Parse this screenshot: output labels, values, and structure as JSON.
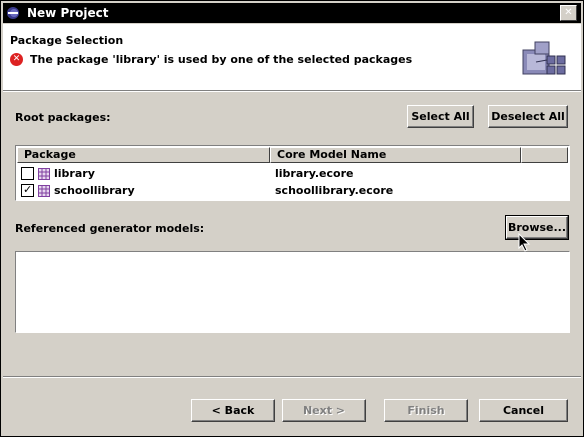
{
  "window": {
    "title": "New Project",
    "close_glyph": "✕"
  },
  "header": {
    "title": "Package Selection",
    "error_message": "The package 'library' is used by one of the selected packages",
    "error_icon": "error-icon",
    "wizard_icon": "package-wizard-icon"
  },
  "root_packages": {
    "label": "Root packages:",
    "select_all": "Select All",
    "deselect_all": "Deselect All",
    "columns": [
      "Package",
      "Core Model Name"
    ],
    "rows": [
      {
        "checked": false,
        "package": "library",
        "core_model": "library.ecore"
      },
      {
        "checked": true,
        "package": "schoollibrary",
        "core_model": "schoollibrary.ecore"
      }
    ]
  },
  "referenced": {
    "label": "Referenced generator models:",
    "browse": "Browse..."
  },
  "footer": {
    "back": "< Back",
    "next": "Next >",
    "finish": "Finish",
    "cancel": "Cancel"
  }
}
